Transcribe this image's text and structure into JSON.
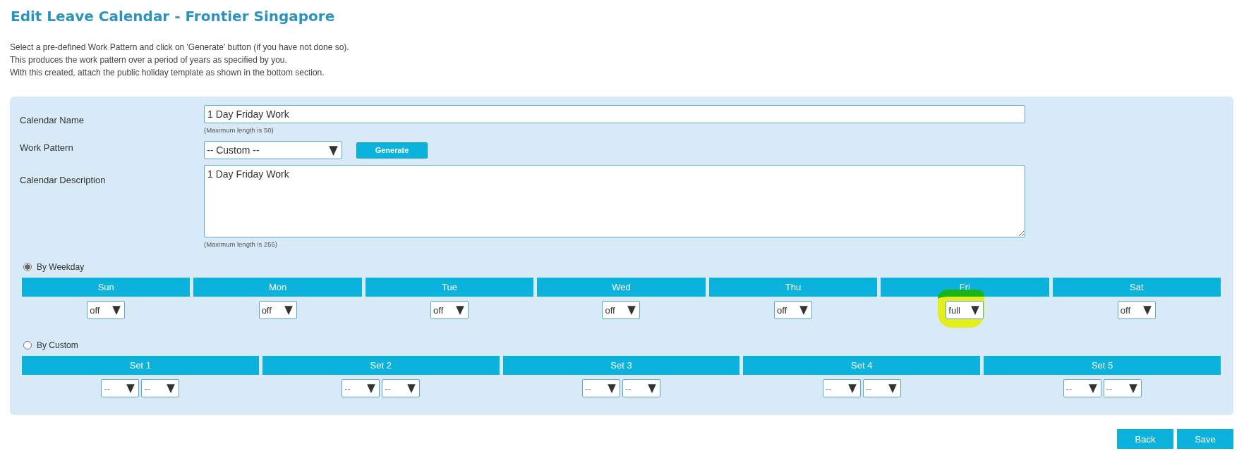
{
  "title": "Edit Leave Calendar - Frontier Singapore",
  "intro": [
    "Select a pre-defined Work Pattern and click on 'Generate' button (if you have not done so).",
    "This produces the work pattern over a period of years as specified by you.",
    "With this created, attach the public holiday template as shown in the bottom section."
  ],
  "form": {
    "calendar_name": {
      "label": "Calendar Name",
      "value": "1 Day Friday Work",
      "hint": "(Maximum length is 50)"
    },
    "work_pattern": {
      "label": "Work Pattern",
      "value": "-- Custom --",
      "button": "Generate"
    },
    "calendar_description": {
      "label": "Calendar Description",
      "value": "1 Day Friday Work",
      "hint": "(Maximum length is 255)"
    }
  },
  "by_weekday": {
    "label": "By Weekday",
    "selected": true,
    "days": [
      {
        "label": "Sun",
        "value": "off",
        "highlighted": false
      },
      {
        "label": "Mon",
        "value": "off",
        "highlighted": false
      },
      {
        "label": "Tue",
        "value": "off",
        "highlighted": false
      },
      {
        "label": "Wed",
        "value": "off",
        "highlighted": false
      },
      {
        "label": "Thu",
        "value": "off",
        "highlighted": false
      },
      {
        "label": "Fri",
        "value": "full",
        "highlighted": true
      },
      {
        "label": "Sat",
        "value": "off",
        "highlighted": false
      }
    ]
  },
  "by_custom": {
    "label": "By Custom",
    "selected": false,
    "sets": [
      {
        "label": "Set 1",
        "values": [
          "--",
          "--"
        ]
      },
      {
        "label": "Set 2",
        "values": [
          "--",
          "--"
        ]
      },
      {
        "label": "Set 3",
        "values": [
          "--",
          "--"
        ]
      },
      {
        "label": "Set 4",
        "values": [
          "--",
          "--"
        ]
      },
      {
        "label": "Set 5",
        "values": [
          "--",
          "--"
        ]
      }
    ]
  },
  "buttons": [
    "Back",
    "Save"
  ]
}
